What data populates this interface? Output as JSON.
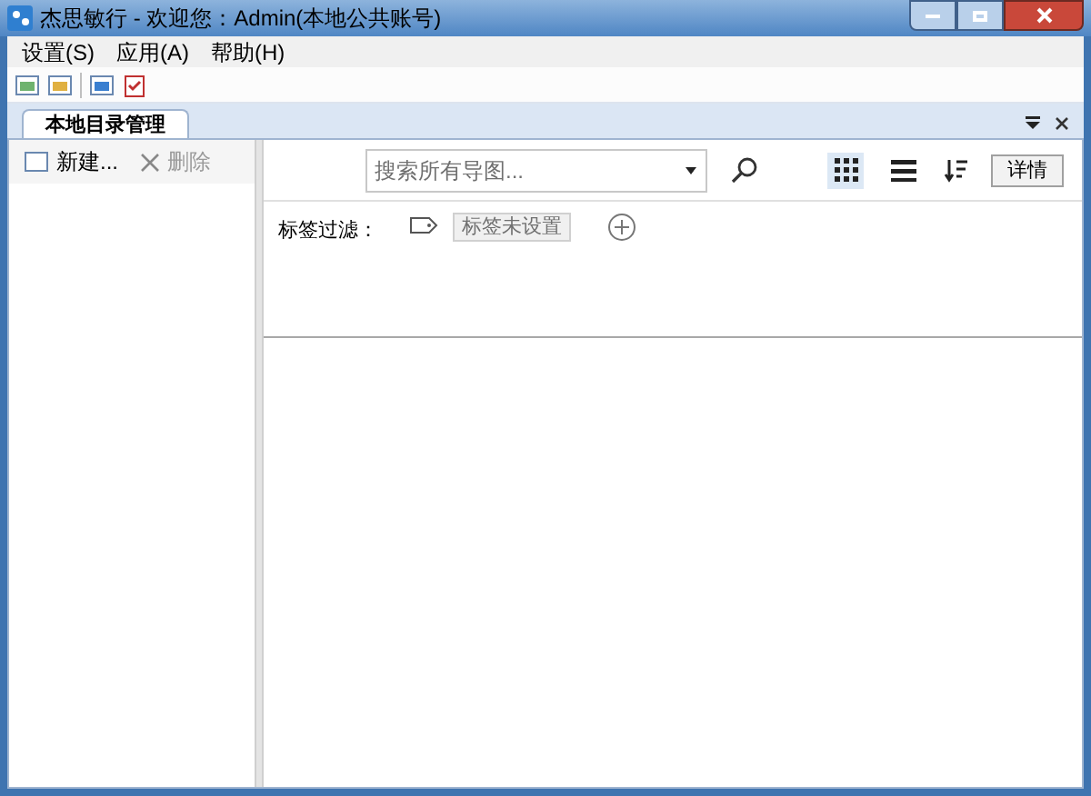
{
  "window": {
    "title": "杰思敏行 - 欢迎您：Admin(本地公共账号)"
  },
  "menu": [
    "设置(S)",
    "应用(A)",
    "帮助(H)"
  ],
  "tabs": [
    {
      "label": "本地目录管理",
      "selected": true
    }
  ],
  "left_toolbar": [
    {
      "label": "新建...",
      "kind": "new",
      "disabled": false
    },
    {
      "label": "删除",
      "kind": "delete",
      "disabled": true
    }
  ],
  "search": {
    "placeholder": "搜索所有导图..."
  },
  "views": [
    {
      "kind": "grid",
      "selected": true
    },
    {
      "kind": "list",
      "selected": false
    }
  ],
  "details_button": "详情",
  "tag_filter": {
    "label": "标签过滤：",
    "tag": "标签未设置"
  }
}
